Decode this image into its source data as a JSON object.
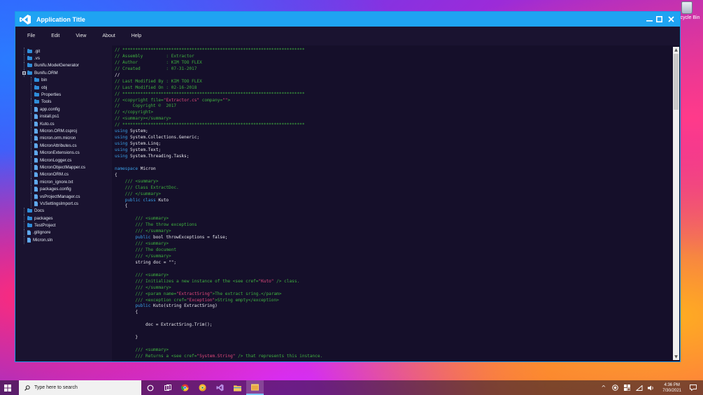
{
  "desktop": {
    "recycle_bin_label": "Recycle Bin"
  },
  "window": {
    "title": "Application Title",
    "minimize_glyph": "—",
    "maximize_glyph": "□",
    "close_glyph": "✕"
  },
  "menu": [
    {
      "label": "File"
    },
    {
      "label": "Edit"
    },
    {
      "label": "View"
    },
    {
      "label": "About"
    },
    {
      "label": "Help"
    }
  ],
  "explorer": {
    "items": [
      {
        "label": ".git",
        "kind": "folder",
        "depth": 0
      },
      {
        "label": ".vs",
        "kind": "folder",
        "depth": 0
      },
      {
        "label": "Bunifu.ModelGenerator",
        "kind": "folder",
        "depth": 0
      },
      {
        "label": "Bunifu.ORM",
        "kind": "folder",
        "depth": 0,
        "expanded": true
      },
      {
        "label": "bin",
        "kind": "folder",
        "depth": 1
      },
      {
        "label": "obj",
        "kind": "folder",
        "depth": 1
      },
      {
        "label": "Properties",
        "kind": "folder",
        "depth": 1
      },
      {
        "label": "Tools",
        "kind": "folder",
        "depth": 1
      },
      {
        "label": "app.config",
        "kind": "file",
        "depth": 1
      },
      {
        "label": "install.ps1",
        "kind": "file",
        "depth": 1
      },
      {
        "label": "Kuto.cs",
        "kind": "file",
        "depth": 1
      },
      {
        "label": "Micron.ORM.csproj",
        "kind": "file",
        "depth": 1
      },
      {
        "label": "micron.orm.micron",
        "kind": "file",
        "depth": 1
      },
      {
        "label": "MicronAttributes.cs",
        "kind": "file",
        "depth": 1
      },
      {
        "label": "MicronExtensions.cs",
        "kind": "file",
        "depth": 1
      },
      {
        "label": "MicronLogger.cs",
        "kind": "file",
        "depth": 1
      },
      {
        "label": "MicronObjectMapper.cs",
        "kind": "file",
        "depth": 1
      },
      {
        "label": "MicronORM.cs",
        "kind": "file",
        "depth": 1
      },
      {
        "label": "micron_ignore.txt",
        "kind": "file",
        "depth": 1
      },
      {
        "label": "packages.config",
        "kind": "file",
        "depth": 1
      },
      {
        "label": "vsProjectManager.cs",
        "kind": "file",
        "depth": 1
      },
      {
        "label": "VsSettingsImport.cs",
        "kind": "file",
        "depth": 1
      },
      {
        "label": "Docs",
        "kind": "folder",
        "depth": 0
      },
      {
        "label": "packages",
        "kind": "folder",
        "depth": 0
      },
      {
        "label": "TestProject",
        "kind": "folder",
        "depth": 0
      },
      {
        "label": ".gitignore",
        "kind": "file",
        "depth": 0
      },
      {
        "label": "Micron.sln",
        "kind": "file",
        "depth": 0
      }
    ]
  },
  "editor": {
    "lines": [
      [
        {
          "t": "// ***********************************************************************",
          "c": "green"
        }
      ],
      [
        {
          "t": "// Assembly         : Extractor",
          "c": "green"
        }
      ],
      [
        {
          "t": "// Author           : KIM TOO FLEX",
          "c": "green"
        }
      ],
      [
        {
          "t": "// Created          : 07-31-2017",
          "c": "green"
        }
      ],
      [
        {
          "t": "//",
          "c": "white"
        }
      ],
      [
        {
          "t": "// Last Modified By : KIM TOO FLEX",
          "c": "green"
        }
      ],
      [
        {
          "t": "// Last Modified On : 02-16-2018",
          "c": "green"
        }
      ],
      [
        {
          "t": "// ***********************************************************************",
          "c": "green"
        }
      ],
      [
        {
          "t": "// <copyright file=",
          "c": "green"
        },
        {
          "t": "\"Extractor.cs\"",
          "c": "red"
        },
        {
          "t": " company=",
          "c": "green"
        },
        {
          "t": "\"\"",
          "c": "red"
        },
        {
          "t": ">",
          "c": "green"
        }
      ],
      [
        {
          "t": "//     Copyright ©  2017",
          "c": "green"
        }
      ],
      [
        {
          "t": "// </copyright>",
          "c": "green"
        }
      ],
      [
        {
          "t": "// <summary></summary>",
          "c": "green"
        }
      ],
      [
        {
          "t": "// ***********************************************************************",
          "c": "green"
        }
      ],
      [
        {
          "t": "using",
          "c": "blue"
        },
        {
          "t": " System;",
          "c": "white"
        }
      ],
      [
        {
          "t": "using",
          "c": "blue"
        },
        {
          "t": " System.Collections.Generic;",
          "c": "white"
        }
      ],
      [
        {
          "t": "using",
          "c": "blue"
        },
        {
          "t": " System.Linq;",
          "c": "white"
        }
      ],
      [
        {
          "t": "using",
          "c": "blue"
        },
        {
          "t": " System.Text;",
          "c": "white"
        }
      ],
      [
        {
          "t": "using",
          "c": "blue"
        },
        {
          "t": " System.Threading.Tasks;",
          "c": "white"
        }
      ],
      [
        {
          "t": "",
          "c": "white"
        }
      ],
      [
        {
          "t": "namespace",
          "c": "blue"
        },
        {
          "t": " Micron",
          "c": "white"
        }
      ],
      [
        {
          "t": "{",
          "c": "white"
        }
      ],
      [
        {
          "t": "    /// <summary>",
          "c": "green"
        }
      ],
      [
        {
          "t": "    /// Class ExtractDoc.",
          "c": "green"
        }
      ],
      [
        {
          "t": "    /// </summary>",
          "c": "green"
        }
      ],
      [
        {
          "t": "    ",
          "c": "white"
        },
        {
          "t": "public class",
          "c": "blue"
        },
        {
          "t": " Kuto",
          "c": "white"
        }
      ],
      [
        {
          "t": "    {",
          "c": "white"
        }
      ],
      [
        {
          "t": "",
          "c": "white"
        }
      ],
      [
        {
          "t": "        /// <summary>",
          "c": "green"
        }
      ],
      [
        {
          "t": "        /// The throw exceptions",
          "c": "green"
        }
      ],
      [
        {
          "t": "        /// </summary>",
          "c": "green"
        }
      ],
      [
        {
          "t": "        ",
          "c": "white"
        },
        {
          "t": "public",
          "c": "blue"
        },
        {
          "t": " bool throwExceptions = false;",
          "c": "white"
        }
      ],
      [
        {
          "t": "        /// <summary>",
          "c": "green"
        }
      ],
      [
        {
          "t": "        /// The document",
          "c": "green"
        }
      ],
      [
        {
          "t": "        /// </summary>",
          "c": "green"
        }
      ],
      [
        {
          "t": "        string doc = \"\";",
          "c": "white"
        }
      ],
      [
        {
          "t": "",
          "c": "white"
        }
      ],
      [
        {
          "t": "        /// <summary>",
          "c": "green"
        }
      ],
      [
        {
          "t": "        /// Initializes a new instance of the <see cref=",
          "c": "green"
        },
        {
          "t": "\"Kuto\"",
          "c": "red"
        },
        {
          "t": " /> class.",
          "c": "green"
        }
      ],
      [
        {
          "t": "        /// </summary>",
          "c": "green"
        }
      ],
      [
        {
          "t": "        /// <param name=",
          "c": "green"
        },
        {
          "t": "\"ExtractSring\"",
          "c": "red"
        },
        {
          "t": ">The extract sring.</param>",
          "c": "green"
        }
      ],
      [
        {
          "t": "        /// <exception cref=",
          "c": "green"
        },
        {
          "t": "\"Exception\"",
          "c": "red"
        },
        {
          "t": ">String empty</exception>",
          "c": "green"
        }
      ],
      [
        {
          "t": "        ",
          "c": "white"
        },
        {
          "t": "public",
          "c": "blue"
        },
        {
          "t": " Kuto(string ExtractSring)",
          "c": "white"
        }
      ],
      [
        {
          "t": "        {",
          "c": "white"
        }
      ],
      [
        {
          "t": "",
          "c": "white"
        }
      ],
      [
        {
          "t": "            doc = ExtractSring.Trim();",
          "c": "white"
        }
      ],
      [
        {
          "t": "",
          "c": "white"
        }
      ],
      [
        {
          "t": "        }",
          "c": "white"
        }
      ],
      [
        {
          "t": "",
          "c": "white"
        }
      ],
      [
        {
          "t": "        /// <summary>",
          "c": "green"
        }
      ],
      [
        {
          "t": "        /// Returns a <see cref=",
          "c": "green"
        },
        {
          "t": "\"System.String\"",
          "c": "red"
        },
        {
          "t": " /> that represents this instance.",
          "c": "green"
        }
      ]
    ],
    "scroll_up_glyph": "▲",
    "scroll_down_glyph": "▼"
  },
  "taskbar": {
    "search_placeholder": "Type here to search",
    "time": "4:36 PM",
    "date": "7/30/2021",
    "apps": [
      "cortana-icon",
      "task-view-icon",
      "chrome-icon",
      "chrome-canary-icon",
      "visual-studio-icon",
      "file-explorer-icon",
      "app-window-icon"
    ],
    "tray_chevron": "^"
  },
  "colors": {
    "titlebar": "#1fa3f2",
    "window_bg": "#1a1330",
    "editor_bg": "#150f2a",
    "comment": "#3fb13f",
    "keyword": "#3a9fe6",
    "string": "#e44a7c"
  }
}
